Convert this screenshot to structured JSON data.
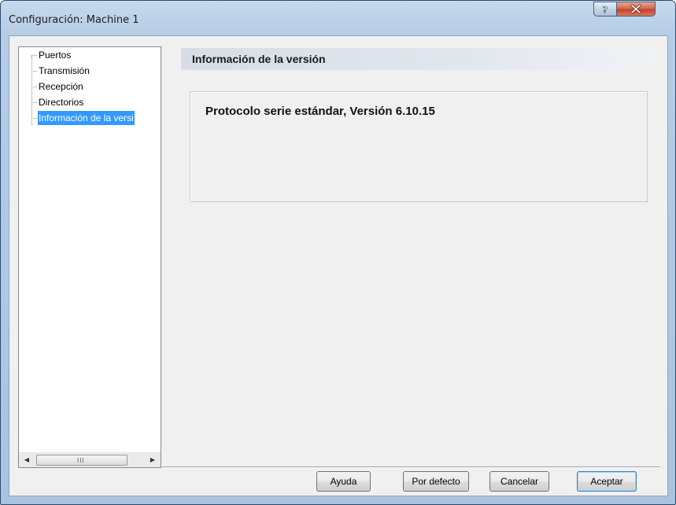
{
  "window": {
    "title": "Configuración: Machine 1",
    "help_glyph": "?",
    "close_glyph": "X"
  },
  "tree": {
    "items": [
      {
        "label": "Puertos",
        "selected": false
      },
      {
        "label": "Transmisión",
        "selected": false
      },
      {
        "label": "Recepción",
        "selected": false
      },
      {
        "label": "Directorios",
        "selected": false
      },
      {
        "label": "Información de la versi",
        "selected": true
      }
    ],
    "scroll_left_icon": "arrow-left-icon",
    "scroll_right_icon": "arrow-right-icon",
    "scroll_grip": "III"
  },
  "section": {
    "header": "Información de la versión",
    "info_text": "Protocolo serie estándar, Versión 6.10.15"
  },
  "buttons": {
    "help": "Ayuda",
    "defaults": "Por defecto",
    "cancel": "Cancelar",
    "ok": "Aceptar"
  },
  "colors": {
    "selection": "#3399ff",
    "default_button_border": "#3c7fb1",
    "close_button": "#c2432a"
  }
}
